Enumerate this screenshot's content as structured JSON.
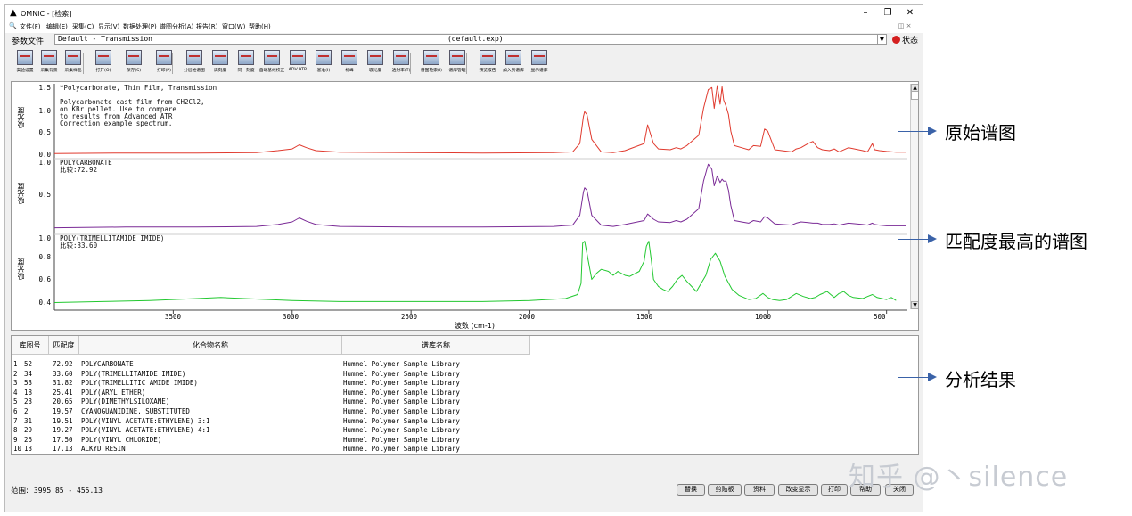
{
  "window": {
    "title": "OMNIC - [检索]",
    "menu": [
      "文件(F)",
      "编辑(E)",
      "采集(C)",
      "显示(V)",
      "数据处理(P)",
      "谱图分析(A)",
      "报告(R)",
      "窗口(W)",
      "帮助(H)"
    ],
    "mdi_controls": "_ ◫ ×",
    "window_controls": {
      "minimize": "–",
      "restore": "❐",
      "close": "✕"
    }
  },
  "param": {
    "label": "参数文件:",
    "value": "Default - Transmission",
    "center": "(default.exp)",
    "status_label": "状态"
  },
  "toolbar": [
    {
      "label": "实验设置",
      "icon": "experiment-setup-icon"
    },
    {
      "label": "采集背景",
      "icon": "collect-background-icon"
    },
    {
      "label": "采集样品",
      "icon": "collect-sample-icon"
    },
    {
      "label": "打开(O)",
      "icon": "open-icon"
    },
    {
      "label": "保存(S)",
      "icon": "save-icon"
    },
    {
      "label": "打印(P)",
      "icon": "print-icon"
    },
    {
      "label": "分层堆谱图",
      "icon": "stack-spectra-icon"
    },
    {
      "label": "满刻度",
      "icon": "full-scale-icon"
    },
    {
      "label": "同一刻度",
      "icon": "common-scale-icon"
    },
    {
      "label": "自动基线校正",
      "icon": "auto-baseline-icon"
    },
    {
      "label": "ADV ATR",
      "icon": "adv-atr-icon"
    },
    {
      "label": "基准(I)",
      "icon": "baseline-icon"
    },
    {
      "label": "标峰",
      "icon": "find-peaks-icon"
    },
    {
      "label": "吸光度",
      "icon": "absorbance-icon"
    },
    {
      "label": "透射率(T)",
      "icon": "transmittance-icon"
    },
    {
      "label": "谱图检索(I)",
      "icon": "spectral-search-icon"
    },
    {
      "label": "谱库管理",
      "icon": "library-manager-icon"
    },
    {
      "label": "预览报告",
      "icon": "preview-report-icon"
    },
    {
      "label": "加入到谱库",
      "icon": "add-to-library-icon"
    },
    {
      "label": "显示谱库",
      "icon": "show-library-icon"
    }
  ],
  "panes": [
    {
      "ylabel": "吸光度",
      "header": "*Polycarbonate, Thin Film, Transmission\n\nPolycarbonate cast film from CH2Cl2,\non KBr pellet. Use to compare\nto results from Advanced ATR\nCorrection example spectrum.",
      "yticks": [
        "1.5",
        "1.0",
        "0.5",
        "0.0"
      ],
      "color": "#e03a2e"
    },
    {
      "ylabel": "吸光度",
      "header": "POLYCARBONATE\n比较:72.92",
      "yticks": [
        "1.0",
        "0.5"
      ],
      "color": "#7a2a96"
    },
    {
      "ylabel": "吸光度",
      "header": "POLY(TRIMELLITAMIDE IMIDE)\n比较:33.60",
      "yticks": [
        "1.0",
        "0.8",
        "0.6",
        "0.4"
      ],
      "color": "#22c830"
    }
  ],
  "chart_data": {
    "type": "line",
    "xlabel": "波数 (cm-1)",
    "xticks": [
      3500,
      3000,
      2500,
      2000,
      1500,
      1000,
      500
    ],
    "xlim": [
      4000,
      420
    ],
    "series": [
      {
        "name": "*Polycarbonate, Thin Film, Transmission",
        "ylim": [
          -0.05,
          1.65
        ],
        "x": [
          4000,
          3700,
          3400,
          3150,
          3060,
          3000,
          2970,
          2940,
          2900,
          2800,
          2500,
          2200,
          1900,
          1820,
          1790,
          1775,
          1770,
          1760,
          1740,
          1700,
          1650,
          1600,
          1520,
          1505,
          1480,
          1460,
          1410,
          1385,
          1365,
          1340,
          1290,
          1270,
          1250,
          1235,
          1225,
          1212,
          1200,
          1192,
          1185,
          1175,
          1165,
          1155,
          1140,
          1110,
          1080,
          1060,
          1030,
          1013,
          1000,
          970,
          900,
          880,
          860,
          830,
          810,
          790,
          770,
          740,
          720,
          700,
          660,
          600,
          580,
          560,
          550,
          530,
          500,
          460,
          420
        ],
        "y": [
          0.01,
          0.02,
          0.02,
          0.03,
          0.08,
          0.12,
          0.22,
          0.15,
          0.08,
          0.04,
          0.03,
          0.02,
          0.03,
          0.05,
          0.25,
          0.9,
          1.02,
          0.95,
          0.35,
          0.05,
          0.03,
          0.08,
          0.25,
          0.7,
          0.25,
          0.12,
          0.1,
          0.15,
          0.12,
          0.2,
          0.45,
          1.1,
          1.55,
          1.6,
          1.1,
          1.65,
          1.2,
          1.62,
          1.3,
          1.15,
          0.95,
          0.55,
          0.2,
          0.15,
          0.1,
          0.2,
          0.18,
          0.6,
          0.55,
          0.1,
          0.05,
          0.12,
          0.15,
          0.25,
          0.3,
          0.15,
          0.1,
          0.08,
          0.12,
          0.05,
          0.15,
          0.08,
          0.05,
          0.25,
          0.1,
          0.08,
          0.06,
          0.04,
          0.04
        ]
      },
      {
        "name": "POLYCARBONATE",
        "ylim": [
          -0.05,
          1.05
        ],
        "x": [
          4000,
          3700,
          3400,
          3150,
          3060,
          3000,
          2970,
          2940,
          2900,
          2800,
          2500,
          2200,
          1900,
          1820,
          1790,
          1775,
          1770,
          1760,
          1740,
          1700,
          1650,
          1600,
          1520,
          1505,
          1480,
          1460,
          1410,
          1385,
          1365,
          1340,
          1290,
          1270,
          1250,
          1235,
          1225,
          1212,
          1200,
          1192,
          1185,
          1175,
          1165,
          1155,
          1140,
          1110,
          1080,
          1060,
          1030,
          1013,
          1000,
          970,
          900,
          880,
          860,
          830,
          810,
          790,
          770,
          740,
          720,
          700,
          660,
          600,
          580,
          560,
          550,
          530,
          500,
          460,
          420
        ],
        "y": [
          0.01,
          0.02,
          0.02,
          0.03,
          0.06,
          0.1,
          0.16,
          0.11,
          0.06,
          0.03,
          0.02,
          0.02,
          0.03,
          0.05,
          0.2,
          0.55,
          0.62,
          0.58,
          0.2,
          0.05,
          0.03,
          0.06,
          0.12,
          0.22,
          0.14,
          0.1,
          0.09,
          0.12,
          0.1,
          0.14,
          0.3,
          0.72,
          0.98,
          0.9,
          0.65,
          0.8,
          0.7,
          0.75,
          0.72,
          0.72,
          0.58,
          0.35,
          0.12,
          0.1,
          0.08,
          0.12,
          0.1,
          0.18,
          0.16,
          0.07,
          0.05,
          0.08,
          0.1,
          0.09,
          0.08,
          0.08,
          0.06,
          0.06,
          0.07,
          0.05,
          0.08,
          0.06,
          0.05,
          0.08,
          0.06,
          0.05,
          0.04,
          0.04,
          0.04
        ]
      },
      {
        "name": "POLY(TRIMELLITAMIDE IMIDE)",
        "ylim": [
          0.35,
          1.05
        ],
        "x": [
          4000,
          3800,
          3600,
          3400,
          3300,
          3200,
          3100,
          3000,
          2800,
          2500,
          2200,
          2000,
          1850,
          1800,
          1785,
          1778,
          1770,
          1740,
          1720,
          1700,
          1670,
          1650,
          1630,
          1600,
          1580,
          1540,
          1520,
          1510,
          1500,
          1490,
          1480,
          1460,
          1440,
          1420,
          1400,
          1380,
          1360,
          1340,
          1320,
          1300,
          1280,
          1260,
          1240,
          1220,
          1200,
          1180,
          1150,
          1120,
          1100,
          1080,
          1050,
          1020,
          1000,
          980,
          950,
          920,
          900,
          880,
          850,
          820,
          800,
          780,
          750,
          730,
          720,
          700,
          680,
          660,
          640,
          600,
          580,
          560,
          540,
          520,
          500,
          480,
          460
        ],
        "y": [
          0.39,
          0.4,
          0.41,
          0.43,
          0.44,
          0.43,
          0.42,
          0.41,
          0.4,
          0.4,
          0.4,
          0.41,
          0.43,
          0.47,
          0.58,
          0.98,
          1.0,
          0.62,
          0.68,
          0.72,
          0.7,
          0.66,
          0.7,
          0.66,
          0.65,
          0.7,
          0.8,
          0.95,
          1.0,
          0.82,
          0.62,
          0.55,
          0.52,
          0.5,
          0.55,
          0.62,
          0.66,
          0.6,
          0.55,
          0.5,
          0.58,
          0.66,
          0.82,
          0.88,
          0.8,
          0.65,
          0.52,
          0.46,
          0.44,
          0.42,
          0.43,
          0.48,
          0.44,
          0.42,
          0.41,
          0.42,
          0.45,
          0.48,
          0.45,
          0.43,
          0.44,
          0.47,
          0.5,
          0.46,
          0.44,
          0.48,
          0.5,
          0.46,
          0.44,
          0.43,
          0.45,
          0.47,
          0.44,
          0.43,
          0.42,
          0.44,
          0.41
        ]
      }
    ]
  },
  "results": {
    "headers": [
      "库图号",
      "匹配度",
      "化合物名称",
      "谱库名称"
    ],
    "rows": [
      {
        "n": "1",
        "id": "52",
        "match": "72.92",
        "name": "POLYCARBONATE",
        "lib": "Hummel Polymer Sample Library"
      },
      {
        "n": "2",
        "id": "34",
        "match": "33.60",
        "name": "POLY(TRIMELLITAMIDE IMIDE)",
        "lib": "Hummel Polymer Sample Library"
      },
      {
        "n": "3",
        "id": "53",
        "match": "31.82",
        "name": "POLY(TRIMELLITIC AMIDE IMIDE)",
        "lib": "Hummel Polymer Sample Library"
      },
      {
        "n": "4",
        "id": "18",
        "match": "25.41",
        "name": "POLY(ARYL ETHER)",
        "lib": "Hummel Polymer Sample Library"
      },
      {
        "n": "5",
        "id": "23",
        "match": "20.65",
        "name": "POLY(DIMETHYLSILOXANE)",
        "lib": "Hummel Polymer Sample Library"
      },
      {
        "n": "6",
        "id": "2",
        "match": "19.57",
        "name": "CYANOGUANIDINE, SUBSTITUTED",
        "lib": "Hummel Polymer Sample Library"
      },
      {
        "n": "7",
        "id": "31",
        "match": "19.51",
        "name": "POLY(VINYL ACETATE:ETHYLENE) 3:1",
        "lib": "Hummel Polymer Sample Library"
      },
      {
        "n": "8",
        "id": "29",
        "match": "19.27",
        "name": "POLY(VINYL ACETATE:ETHYLENE) 4:1",
        "lib": "Hummel Polymer Sample Library"
      },
      {
        "n": "9",
        "id": "26",
        "match": "17.50",
        "name": "POLY(VINYL CHLORIDE)",
        "lib": "Hummel Polymer Sample Library"
      },
      {
        "n": "10",
        "id": "13",
        "match": "17.13",
        "name": "ALKYD RESIN",
        "lib": "Hummel Polymer Sample Library"
      }
    ]
  },
  "bottom": {
    "range_label": "范围:",
    "range_value": "3995.85  -  455.13",
    "buttons": [
      "替换",
      "剪贴板",
      "资料",
      "改变显示",
      "打印",
      "帮助",
      "关闭"
    ]
  },
  "annotations": [
    "原始谱图",
    "匹配度最高的谱图",
    "分析结果"
  ],
  "watermark": "知乎 @丶silence",
  "colors": {
    "original": "#e03a2e",
    "match1": "#7a2a96",
    "match2": "#22c830",
    "arrow": "#3a62a8"
  }
}
